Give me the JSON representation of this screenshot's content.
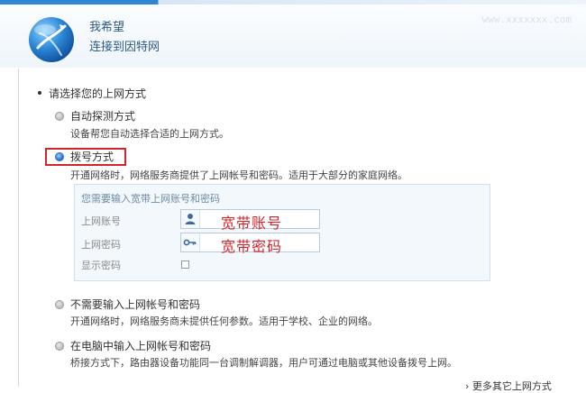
{
  "header": {
    "title": "我希望",
    "subtitle": "连接到因特网",
    "watermark": "www.xxxxxxx.com"
  },
  "section": {
    "heading": "请选择您的上网方式"
  },
  "options": [
    {
      "label": "自动探测方式",
      "description": "设备帮您自动选择合适的上网方式。",
      "checked": false
    },
    {
      "label": "拨号方式",
      "description": "开通网络时，网络服务商提供了上网帐号和密码。适用于大部分的家庭网络。",
      "checked": true
    },
    {
      "label": "不需要输入上网帐号和密码",
      "description": "开通网络时，网络服务商未提供任何参数。适用于学校、企业的网络。",
      "checked": false
    },
    {
      "label": "在电脑中输入上网帐号和密码",
      "description": "桥接方式下，路由器设备功能同一台调制解调器，用户可通过电脑或其他设备拨号上网。",
      "checked": false
    }
  ],
  "dialup_panel": {
    "hint": "您需要输入宽带上网账号和密码",
    "account_label": "上网账号",
    "account_value": "宽带账号",
    "password_label": "上网密码",
    "password_value": "宽带密码",
    "show_password_label": "显示密码",
    "show_password_checked": false
  },
  "footer": {
    "more_link": "更多其它上网方式"
  },
  "colors": {
    "accent_blue": "#1f6ccd",
    "highlight_red": "#d0252a",
    "header_text": "#2c5a86"
  },
  "icons": {
    "logo": "globe-logo-icon",
    "account": "user-icon",
    "password": "key-icon"
  }
}
